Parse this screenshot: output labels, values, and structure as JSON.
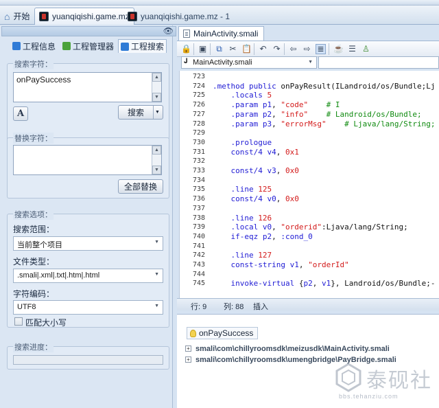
{
  "top_tabs": {
    "start": "开始",
    "tab1": "yuanqiqishi.game.mz",
    "tab2": "yuanqiqishi.game.mz - 1"
  },
  "left_panel": {
    "tabs": [
      "工程信息",
      "工程管理器",
      "工程搜索"
    ],
    "search": {
      "label": "搜索字符：",
      "value": "onPaySuccess",
      "font_button": "A",
      "search_button": "搜索"
    },
    "replace": {
      "label": "替换字符：",
      "value": "",
      "replace_all_button": "全部替换"
    },
    "options": {
      "label": "搜索选项：",
      "scope_label": "搜索范围：",
      "scope_value": "当前整个项目",
      "filetype_label": "文件类型：",
      "filetype_value": ".smali|.xml|.txt|.htm|.html",
      "encoding_label": "字符编码：",
      "encoding_value": "UTF8",
      "match_case_label": "匹配大小写"
    },
    "progress": {
      "label": "搜索进度：",
      "value": 0
    }
  },
  "editor": {
    "tab_label": "MainActivity.smali",
    "file_select": "MainActivity.smali",
    "member_select": "",
    "status": {
      "row": "行: 9",
      "col": "列: 88",
      "mode": "插入"
    },
    "lines": [
      {
        "n": "723",
        "parts": []
      },
      {
        "n": "724",
        "parts": [
          {
            "c": "kw",
            "t": ".method public "
          },
          {
            "c": "pl",
            "t": "onPayResult(ILandroid/os/Bundle;Lj"
          }
        ]
      },
      {
        "n": "725",
        "parts": [
          {
            "c": "pl",
            "t": "    "
          },
          {
            "c": "kw",
            "t": ".locals "
          },
          {
            "c": "str",
            "t": "5"
          }
        ]
      },
      {
        "n": "726",
        "parts": [
          {
            "c": "pl",
            "t": "    "
          },
          {
            "c": "kw",
            "t": ".param "
          },
          {
            "c": "reg",
            "t": "p1"
          },
          {
            "c": "pl",
            "t": ", "
          },
          {
            "c": "str",
            "t": "\"code\""
          },
          {
            "c": "cm",
            "t": "    # I"
          }
        ]
      },
      {
        "n": "727",
        "parts": [
          {
            "c": "pl",
            "t": "    "
          },
          {
            "c": "kw",
            "t": ".param "
          },
          {
            "c": "reg",
            "t": "p2"
          },
          {
            "c": "pl",
            "t": ", "
          },
          {
            "c": "str",
            "t": "\"info\""
          },
          {
            "c": "cm",
            "t": "    # Landroid/os/Bundle;"
          }
        ]
      },
      {
        "n": "728",
        "parts": [
          {
            "c": "pl",
            "t": "    "
          },
          {
            "c": "kw",
            "t": ".param "
          },
          {
            "c": "reg",
            "t": "p3"
          },
          {
            "c": "pl",
            "t": ", "
          },
          {
            "c": "str",
            "t": "\"errorMsg\""
          },
          {
            "c": "cm",
            "t": "    # Ljava/lang/String;"
          }
        ]
      },
      {
        "n": "729",
        "parts": []
      },
      {
        "n": "730",
        "parts": [
          {
            "c": "pl",
            "t": "    "
          },
          {
            "c": "kw",
            "t": ".prologue"
          }
        ]
      },
      {
        "n": "731",
        "parts": [
          {
            "c": "pl",
            "t": "    "
          },
          {
            "c": "kw",
            "t": "const/4 "
          },
          {
            "c": "reg",
            "t": "v4"
          },
          {
            "c": "pl",
            "t": ", "
          },
          {
            "c": "str",
            "t": "0x1"
          }
        ]
      },
      {
        "n": "732",
        "parts": []
      },
      {
        "n": "733",
        "parts": [
          {
            "c": "pl",
            "t": "    "
          },
          {
            "c": "kw",
            "t": "const/4 "
          },
          {
            "c": "reg",
            "t": "v3"
          },
          {
            "c": "pl",
            "t": ", "
          },
          {
            "c": "str",
            "t": "0x0"
          }
        ]
      },
      {
        "n": "734",
        "parts": []
      },
      {
        "n": "735",
        "parts": [
          {
            "c": "pl",
            "t": "    "
          },
          {
            "c": "kw",
            "t": ".line "
          },
          {
            "c": "str",
            "t": "125"
          }
        ]
      },
      {
        "n": "736",
        "parts": [
          {
            "c": "pl",
            "t": "    "
          },
          {
            "c": "kw",
            "t": "const/4 "
          },
          {
            "c": "reg",
            "t": "v0"
          },
          {
            "c": "pl",
            "t": ", "
          },
          {
            "c": "str",
            "t": "0x0"
          }
        ]
      },
      {
        "n": "737",
        "parts": []
      },
      {
        "n": "738",
        "parts": [
          {
            "c": "pl",
            "t": "    "
          },
          {
            "c": "kw",
            "t": ".line "
          },
          {
            "c": "str",
            "t": "126"
          }
        ]
      },
      {
        "n": "739",
        "parts": [
          {
            "c": "pl",
            "t": "    "
          },
          {
            "c": "kw",
            "t": ".local "
          },
          {
            "c": "reg",
            "t": "v0"
          },
          {
            "c": "pl",
            "t": ", "
          },
          {
            "c": "str",
            "t": "\"orderid\""
          },
          {
            "c": "pl",
            "t": ":Ljava/lang/String;"
          }
        ]
      },
      {
        "n": "740",
        "parts": [
          {
            "c": "pl",
            "t": "    "
          },
          {
            "c": "kw",
            "t": "if-eqz "
          },
          {
            "c": "reg",
            "t": "p2"
          },
          {
            "c": "pl",
            "t": ", "
          },
          {
            "c": "kw",
            "t": ":cond_0"
          }
        ]
      },
      {
        "n": "741",
        "parts": []
      },
      {
        "n": "742",
        "parts": [
          {
            "c": "pl",
            "t": "    "
          },
          {
            "c": "kw",
            "t": ".line "
          },
          {
            "c": "str",
            "t": "127"
          }
        ]
      },
      {
        "n": "743",
        "parts": [
          {
            "c": "pl",
            "t": "    "
          },
          {
            "c": "kw",
            "t": "const-string "
          },
          {
            "c": "reg",
            "t": "v1"
          },
          {
            "c": "pl",
            "t": ", "
          },
          {
            "c": "str",
            "t": "\"orderId\""
          }
        ]
      },
      {
        "n": "744",
        "parts": []
      },
      {
        "n": "745",
        "parts": [
          {
            "c": "pl",
            "t": "    "
          },
          {
            "c": "kw",
            "t": "invoke-virtual "
          },
          {
            "c": "pl",
            "t": "{"
          },
          {
            "c": "reg",
            "t": "p2"
          },
          {
            "c": "pl",
            "t": ", "
          },
          {
            "c": "reg",
            "t": "v1"
          },
          {
            "c": "pl",
            "t": "}, Landroid/os/Bundle;-"
          }
        ]
      }
    ]
  },
  "results": {
    "tab_label": "onPaySuccess",
    "items": [
      "smali\\com\\chillyroomsdk\\meizusdk\\MainActivity.smali",
      "smali\\com\\chillyroomsdk\\umengbridge\\PayBridge.smali"
    ]
  },
  "watermark": {
    "text": "泰砚社",
    "url": "bbs.tehanziu.com"
  }
}
